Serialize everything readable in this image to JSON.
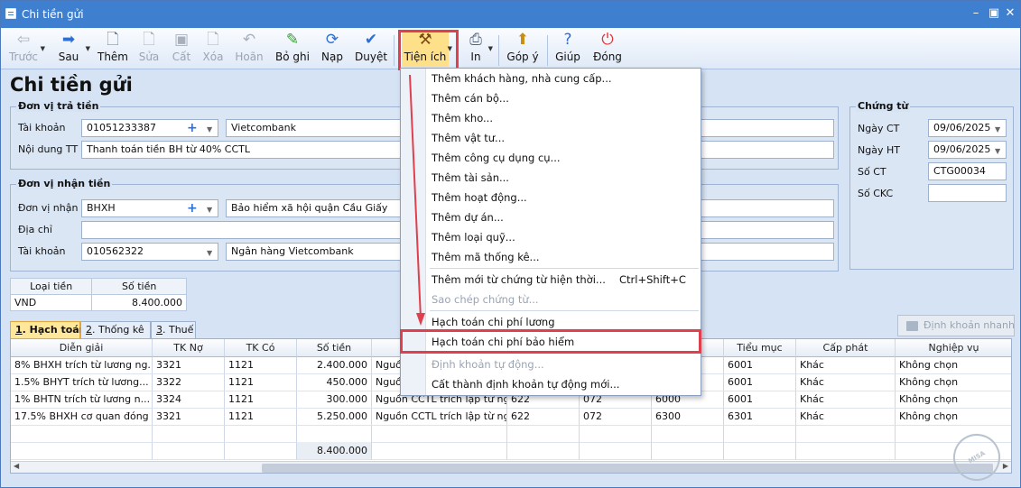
{
  "window": {
    "title": "Chi tiền gửi"
  },
  "toolbar": {
    "items": [
      {
        "label": "Trước",
        "icon": "arrow-left-icon"
      },
      {
        "label": "Sau",
        "icon": "arrow-right-icon"
      },
      {
        "label": "Thêm",
        "icon": "add-doc-icon"
      },
      {
        "label": "Sửa",
        "icon": "edit-doc-icon"
      },
      {
        "label": "Cất",
        "icon": "save-icon"
      },
      {
        "label": "Xóa",
        "icon": "delete-doc-icon"
      },
      {
        "label": "Hoãn",
        "icon": "undo-icon"
      },
      {
        "label": "Bỏ ghi",
        "icon": "unpost-icon"
      },
      {
        "label": "Nạp",
        "icon": "refresh-icon"
      },
      {
        "label": "Duyệt",
        "icon": "check-icon"
      },
      {
        "label": "Tiện ích",
        "icon": "tools-icon"
      },
      {
        "label": "In",
        "icon": "print-icon"
      },
      {
        "label": "Góp ý",
        "icon": "feedback-icon"
      },
      {
        "label": "Giúp",
        "icon": "help-icon"
      },
      {
        "label": "Đóng",
        "icon": "power-icon"
      }
    ]
  },
  "form": {
    "title": "Chi tiền gửi",
    "payer": {
      "group": "Đơn vị trả tiền",
      "account_label": "Tài khoản",
      "account_value": "01051233387",
      "bank_name": "Vietcombank",
      "content_label": "Nội dung TT",
      "content_value": "Thanh toán tiền BH từ 40% CCTL"
    },
    "payee": {
      "group": "Đơn vị nhận tiền",
      "unit_label": "Đơn vị nhận",
      "unit_value": "BHXH",
      "unit_name": "Bảo hiểm xã hội quận Cầu Giấy",
      "address_label": "Địa chỉ",
      "address_value": "",
      "account_label": "Tài khoản",
      "account_value": "010562322",
      "bank_name": "Ngân hàng Vietcombank"
    },
    "voucher": {
      "group": "Chứng từ",
      "date_label": "Ngày CT",
      "date_value": "09/06/2025",
      "post_date_label": "Ngày HT",
      "post_date_value": "09/06/2025",
      "number_label": "Số CT",
      "number_value": "CTG00034",
      "ckc_label": "Số CKC",
      "ckc_value": ""
    },
    "currency": {
      "type_header": "Loại tiền",
      "amount_header": "Số tiền",
      "type_value": "VND",
      "amount_value": "8.400.000"
    }
  },
  "tabs": [
    {
      "num": "1",
      "label": ". Hạch toán"
    },
    {
      "num": "2",
      "label": ". Thống kê"
    },
    {
      "num": "3",
      "label": ". Thuế"
    }
  ],
  "quick_button": "Định khoản nhanh",
  "grid": {
    "headers": [
      "Diễn giải",
      "TK Nợ",
      "TK Có",
      "Số tiền",
      "",
      "",
      "",
      "",
      "Tiểu mục",
      "Cấp phát",
      "Nghiệp vụ"
    ],
    "rows": [
      [
        "8% BHXH trích từ lương ng...",
        "3321",
        "1121",
        "2.400.000",
        "Nguồ",
        "",
        "",
        "",
        "6001",
        "Khác",
        "Không chọn"
      ],
      [
        "1.5% BHYT trích từ lương...",
        "3322",
        "1121",
        "450.000",
        "Nguồ",
        "",
        "",
        "",
        "6001",
        "Khác",
        "Không chọn"
      ],
      [
        "1% BHTN trích từ lương n...",
        "3324",
        "1121",
        "300.000",
        "Nguồn CCTL trích lập từ ng...",
        "622",
        "072",
        "6000",
        "6001",
        "Khác",
        "Không chọn"
      ],
      [
        "17.5% BHXH cơ quan đóng",
        "3321",
        "1121",
        "5.250.000",
        "Nguồn CCTL trích lập từ ng...",
        "622",
        "072",
        "6300",
        "6301",
        "Khác",
        "Không chọn"
      ]
    ],
    "total": "8.400.000"
  },
  "menu": {
    "items": [
      {
        "label": "Thêm khách hàng, nhà cung cấp...",
        "enabled": true
      },
      {
        "label": "Thêm cán bộ...",
        "enabled": true
      },
      {
        "label": "Thêm kho...",
        "enabled": true
      },
      {
        "label": "Thêm vật tư...",
        "enabled": true
      },
      {
        "label": "Thêm công cụ dụng cụ...",
        "enabled": true
      },
      {
        "label": "Thêm tài sản...",
        "enabled": true
      },
      {
        "label": "Thêm hoạt động...",
        "enabled": true
      },
      {
        "label": "Thêm dự án...",
        "enabled": true
      },
      {
        "label": "Thêm loại quỹ...",
        "enabled": true
      },
      {
        "label": "Thêm mã thống kê...",
        "enabled": true
      },
      {
        "label": "Thêm mới từ chứng từ hiện thời...",
        "enabled": true,
        "shortcut": "Ctrl+Shift+C"
      },
      {
        "label": "Sao chép chứng từ...",
        "enabled": false
      },
      {
        "label": "Hạch toán chi phí lương",
        "enabled": true
      },
      {
        "label": "Hạch toán chi phí bảo hiểm",
        "enabled": true
      },
      {
        "label": "Định khoản tự động...",
        "enabled": false
      },
      {
        "label": "Cất thành định khoản tự động mới...",
        "enabled": true
      }
    ]
  },
  "watermark": "MISA",
  "colors": {
    "highlight": "#e0404d",
    "accent": "#3f7fcf"
  }
}
